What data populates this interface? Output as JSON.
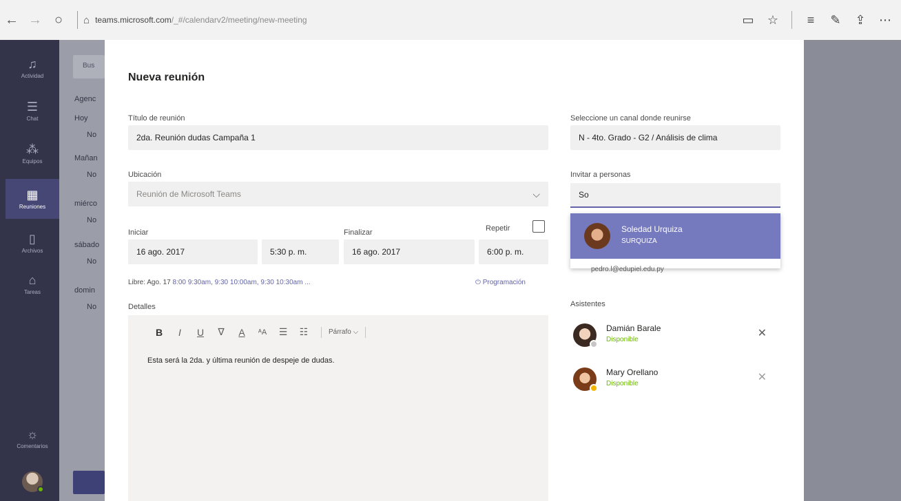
{
  "browser": {
    "url_domain": "teams.microsoft.com",
    "url_path": "/_#/calendarv2/meeting/new-meeting"
  },
  "rail": {
    "items": [
      {
        "label": "Actividad",
        "icon": "bell-icon"
      },
      {
        "label": "Chat",
        "icon": "chat-icon"
      },
      {
        "label": "Equipos",
        "icon": "teams-icon"
      },
      {
        "label": "Reuniones",
        "icon": "calendar-icon"
      },
      {
        "label": "Archivos",
        "icon": "files-icon"
      },
      {
        "label": "Tareas",
        "icon": "tasks-icon"
      },
      {
        "label": "Comentarios",
        "icon": "feedback-icon"
      }
    ]
  },
  "background": {
    "search": "Bus",
    "lines": [
      "Agenc",
      "Hoy",
      "No",
      "Mañan",
      "No",
      "miérco",
      "No",
      "sábado",
      "No",
      "domin",
      "No"
    ]
  },
  "modal": {
    "title": "Nueva reunión",
    "title_label": "Título de reunión",
    "title_value": "2da. Reunión dudas Campaña 1",
    "location_label": "Ubicación",
    "location_value": "Reunión de Microsoft Teams",
    "start_label": "Iniciar",
    "start_date": "16 ago. 2017",
    "start_time": "5:30 p. m.",
    "end_label": "Finalizar",
    "end_date": "16 ago. 2017",
    "end_time": "6:00 p. m.",
    "repeat_label": "Repetir",
    "free_label": "Libre: Ago. 17 ",
    "free_slots": "8:00 9:30am, 9:30 10:00am, 9:30 10:30am ...",
    "schedule_link": "⏻ Programación",
    "details_label": "Detalles",
    "toolbar": {
      "format": "Párrafo ⌵"
    },
    "details_text": "Esta será la 2da. y última reunión de despeje de dudas.",
    "channel_label": "Seleccione un canal donde reunirse",
    "channel_value": "N - 4to. Grado - G2 / Análisis de clima",
    "invite_label": "Invitar a personas",
    "invite_value": "So",
    "dropdown": {
      "name": "Soledad Urquiza",
      "sub": "SURQUIZA",
      "under": "pedro.l@edupiel.edu.py"
    },
    "attendees_label": "Asistentes",
    "attendees": [
      {
        "name": "Damián Barale",
        "status": "Disponible"
      },
      {
        "name": "Mary Orellano",
        "status": "Disponible"
      }
    ]
  }
}
